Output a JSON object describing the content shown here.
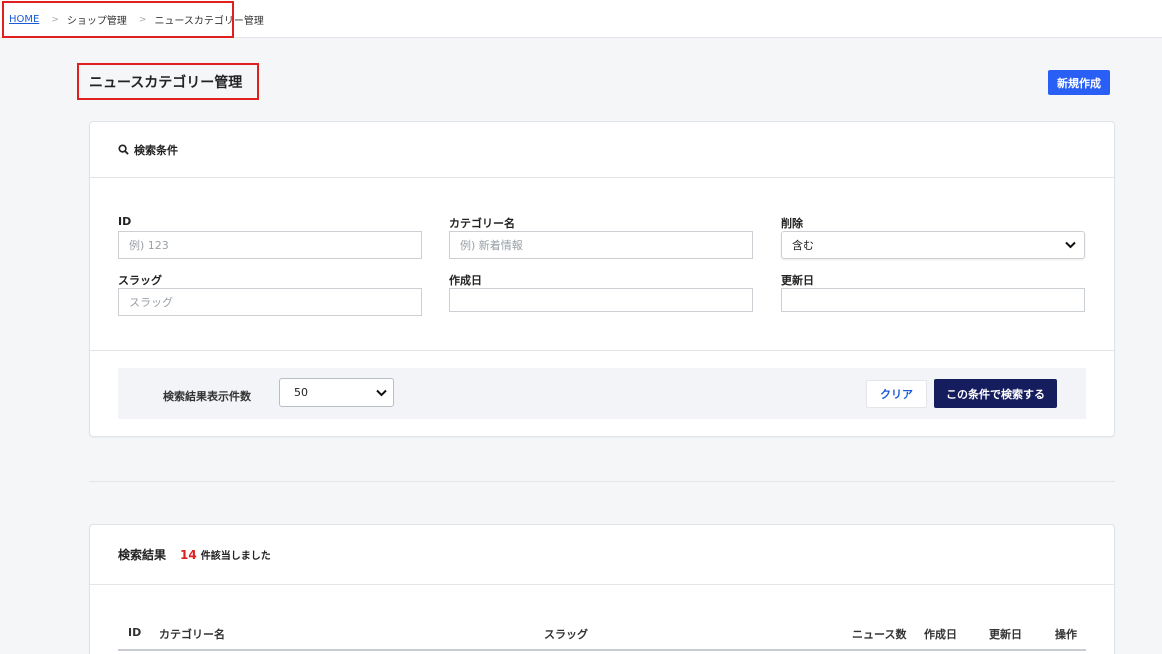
{
  "breadcrumb": {
    "home": "HOME",
    "separator": ">",
    "items": [
      "ショップ管理",
      "ニュースカテゴリー管理"
    ]
  },
  "page": {
    "title": "ニュースカテゴリー管理",
    "new_button": "新規作成"
  },
  "search": {
    "header": "検索条件",
    "fields": {
      "id": {
        "label": "ID",
        "placeholder": "例) 123"
      },
      "category_name": {
        "label": "カテゴリー名",
        "placeholder": "例) 新着情報"
      },
      "deleted": {
        "label": "削除",
        "value": "含む"
      },
      "slug": {
        "label": "スラッグ",
        "placeholder": "スラッグ"
      },
      "created": {
        "label": "作成日"
      },
      "updated": {
        "label": "更新日"
      }
    },
    "per_page_label": "検索結果表示件数",
    "per_page_value": "50",
    "clear_button": "クリア",
    "submit_button": "この条件で検索する"
  },
  "results": {
    "header": "検索結果",
    "count": "14",
    "count_suffix": "件該当しました",
    "columns": [
      "ID",
      "カテゴリー名",
      "スラッグ",
      "ニュース数",
      "作成日",
      "更新日",
      "操作"
    ]
  },
  "colors": {
    "primary": "#2a5ff5",
    "navy": "#151d5e",
    "highlight": "#e0201f"
  }
}
